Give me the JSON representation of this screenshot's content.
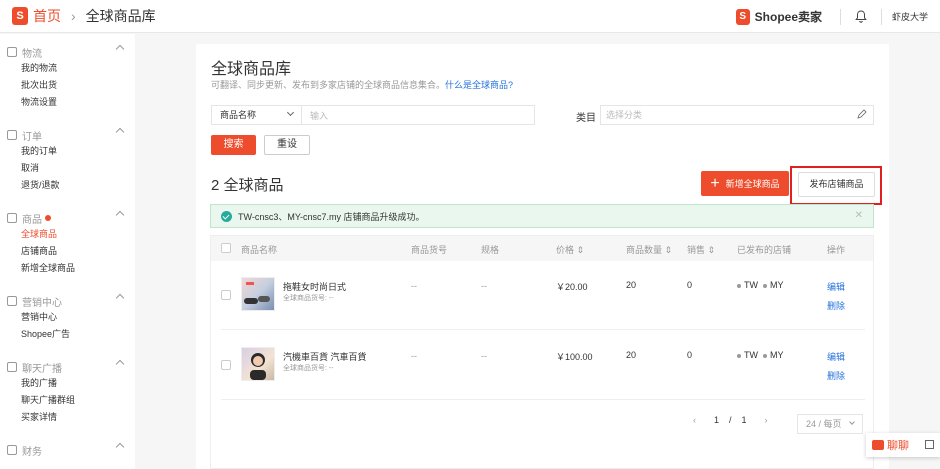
{
  "header": {
    "home_label": "首页",
    "current_page": "全球商品库",
    "brand": "Shopee卖家",
    "user": "虾皮大学"
  },
  "sidebar": {
    "groups": [
      {
        "title": "物流",
        "items": [
          "我的物流",
          "批次出货",
          "物流设置"
        ]
      },
      {
        "title": "订单",
        "items": [
          "我的订单",
          "取消",
          "退货/退款"
        ]
      },
      {
        "title": "商品",
        "items": [
          "全球商品",
          "店铺商品",
          "新增全球商品"
        ],
        "active": "全球商品"
      },
      {
        "title": "营销中心",
        "items": [
          "营销中心",
          "Shopee广告"
        ]
      },
      {
        "title": "聊天广播",
        "items": [
          "我的广播",
          "聊天广播群组",
          "买家详情"
        ]
      },
      {
        "title": "财务",
        "items": []
      }
    ]
  },
  "main": {
    "title": "全球商品库",
    "subtitle": "可翻译、同步更新、发布到多家店铺的全球商品信息集合。",
    "subtitle_link": "什么是全球商品?",
    "filter": {
      "select_value": "商品名称",
      "input_placeholder": "输入",
      "category_label": "类目",
      "category_placeholder": "选择分类"
    },
    "search_label": "搜索",
    "reset_label": "重设",
    "count_title": "2 全球商品",
    "add_label": "新增全球商品",
    "publish_label": "发布店铺商品",
    "alert_text": "TW-cnsc3、MY-cnsc7.my 店铺商品升级成功。",
    "table": {
      "headers": {
        "name": "商品名称",
        "sku": "商品货号",
        "spec": "规格",
        "price": "价格 ⇕",
        "qty": "商品数量 ⇕",
        "sales": "销售 ⇕",
        "shops": "已发布的店铺",
        "ops": "操作"
      },
      "rows": [
        {
          "name": "拖鞋女时尚日式",
          "sku": "全球商品货号: --",
          "code": "--",
          "spec": "--",
          "price": "￥20.00",
          "qty": "20",
          "sales": "0",
          "shop1": "TW",
          "shop2": "MY",
          "edit": "编辑",
          "delete": "删除"
        },
        {
          "name": "汽機車百貨 汽車百貨",
          "sku": "全球商品货号: --",
          "code": "--",
          "spec": "--",
          "price": "￥100.00",
          "qty": "20",
          "sales": "0",
          "shop1": "TW",
          "shop2": "MY",
          "edit": "编辑",
          "delete": "删除"
        }
      ]
    },
    "pager": {
      "current": "1",
      "sep": "/",
      "total": "1",
      "page_size": "24 / 每页"
    }
  },
  "chat": {
    "label": "聊聊"
  },
  "colors": {
    "accent": "#ee4d2d",
    "link": "#2673dd",
    "success_bg": "#eaf7ee"
  }
}
